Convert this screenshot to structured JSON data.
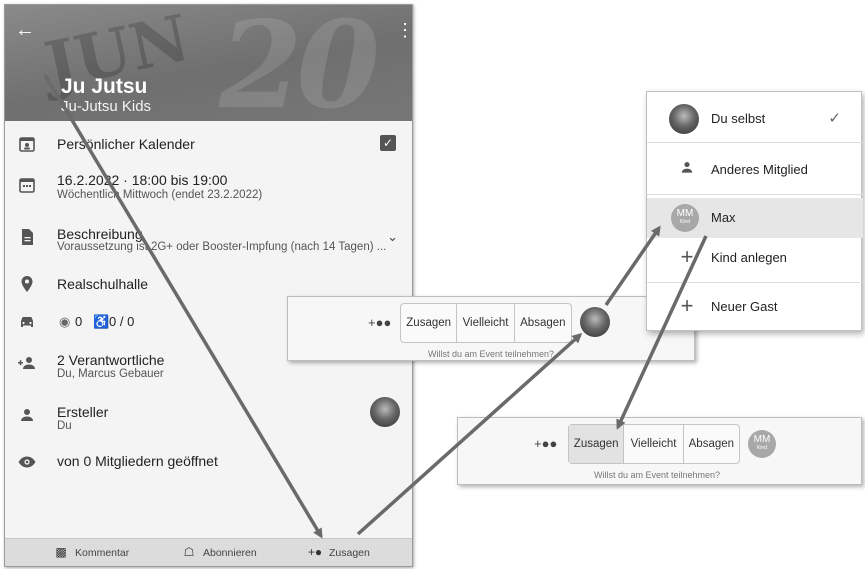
{
  "event": {
    "title": "Ju Jutsu",
    "subtitle": "Ju-Jutsu Kids"
  },
  "details": {
    "calendar_label": "Persönlicher Kalender",
    "date_line": "16.2.2022 · 18:00 bis 19:00",
    "recurrence": "Wöchentlich Mittwoch (endet 23.2.2022)",
    "description_label": "Beschreibung",
    "description_text": "Voraussetzung ist 2G+ oder Booster-Impfung (nach 14 Tagen) ...",
    "location": "Realschulhalle",
    "carpool_seats": "0",
    "accessible_seats": "0 / 0",
    "responsible_title": "2 Verantwortliche",
    "responsible_names": "Du, Marcus Gebauer",
    "creator_label": "Ersteller",
    "creator_name": "Du",
    "opened_by": "von 0 Mitgliedern geöffnet"
  },
  "bottom_bar": {
    "comment": "Kommentar",
    "subscribe": "Abonnieren",
    "rsvp": "Zusagen"
  },
  "rsvp_popup": {
    "accept": "Zusagen",
    "maybe": "Vielleicht",
    "decline": "Absagen",
    "hint": "Willst du am Event teilnehmen?"
  },
  "person_menu": {
    "self": "Du selbst",
    "other_member": "Anderes Mitglied",
    "child_name": "Max",
    "add_child": "Kind anlegen",
    "new_guest": "Neuer Gast"
  },
  "child_avatar": {
    "initials": "MM",
    "tag": "Kind"
  },
  "colors": {
    "accent": "#555555",
    "highlight": "#e6e6e6",
    "arrow": "#6a6a6a"
  }
}
